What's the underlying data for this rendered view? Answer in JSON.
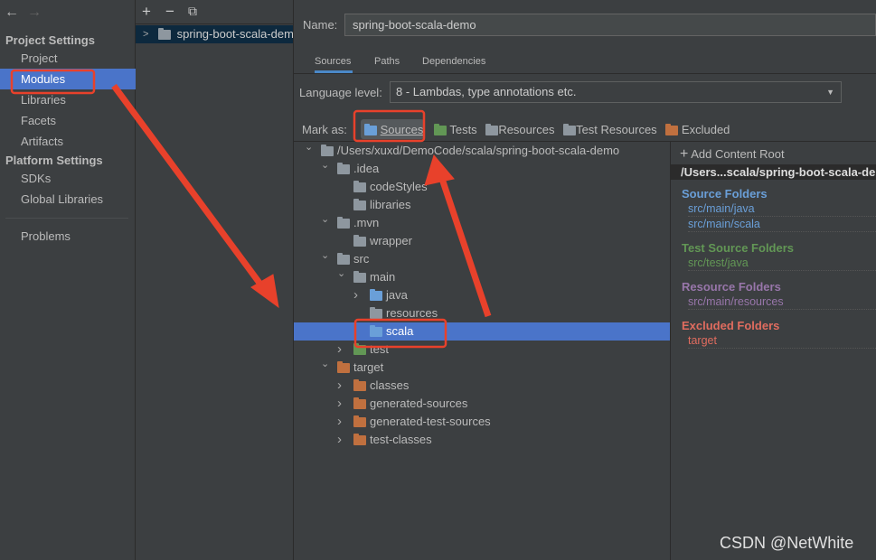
{
  "nav": {
    "back": "←",
    "forward": "→",
    "project_settings": "Project Settings",
    "items1": [
      "Project",
      "Modules",
      "Libraries",
      "Facets",
      "Artifacts"
    ],
    "platform_settings": "Platform Settings",
    "items2": [
      "SDKs",
      "Global Libraries"
    ],
    "problems": "Problems",
    "selected": "Modules"
  },
  "modules": {
    "add": "+",
    "remove": "−",
    "copy": "⧉",
    "module": "spring-boot-scala-demo"
  },
  "form": {
    "name_label": "Name:",
    "name_value": "spring-boot-scala-demo",
    "tabs": [
      "Sources",
      "Paths",
      "Dependencies"
    ],
    "active_tab": "Sources",
    "language_label": "Language level:",
    "language_value": "8 - Lambdas, type annotations etc.",
    "mark_label": "Mark as:",
    "marks": [
      "Sources",
      "Tests",
      "Resources",
      "Test Resources",
      "Excluded"
    ]
  },
  "tree": [
    {
      "label": "/Users/xuxd/DemoCode/scala/spring-boot-scala-demo",
      "level": 0,
      "chevron": "open",
      "type": "module"
    },
    {
      "label": ".idea",
      "level": 1,
      "chevron": "open",
      "type": "plain"
    },
    {
      "label": "codeStyles",
      "level": 2,
      "chevron": "none",
      "type": "plain"
    },
    {
      "label": "libraries",
      "level": 2,
      "chevron": "none",
      "type": "plain"
    },
    {
      "label": ".mvn",
      "level": 1,
      "chevron": "open",
      "type": "plain"
    },
    {
      "label": "wrapper",
      "level": 2,
      "chevron": "none",
      "type": "plain"
    },
    {
      "label": "src",
      "level": 1,
      "chevron": "open",
      "type": "plain"
    },
    {
      "label": "main",
      "level": 2,
      "chevron": "open",
      "type": "plain"
    },
    {
      "label": "java",
      "level": 3,
      "chevron": "closed",
      "type": "source"
    },
    {
      "label": "resources",
      "level": 3,
      "chevron": "none",
      "type": "resource"
    },
    {
      "label": "scala",
      "level": 3,
      "chevron": "none",
      "type": "source",
      "selected": true
    },
    {
      "label": "test",
      "level": 2,
      "chevron": "closed",
      "type": "test"
    },
    {
      "label": "target",
      "level": 1,
      "chevron": "open",
      "type": "excluded"
    },
    {
      "label": "classes",
      "level": 2,
      "chevron": "closed",
      "type": "excluded"
    },
    {
      "label": "generated-sources",
      "level": 2,
      "chevron": "closed",
      "type": "excluded"
    },
    {
      "label": "generated-test-sources",
      "level": 2,
      "chevron": "closed",
      "type": "excluded"
    },
    {
      "label": "test-classes",
      "level": 2,
      "chevron": "closed",
      "type": "excluded"
    }
  ],
  "roots": {
    "add": "Add Content Root",
    "root_path": "/Users...scala/spring-boot-scala-demo",
    "source_title": "Source Folders",
    "source": [
      "src/main/java",
      "src/main/scala"
    ],
    "test_title": "Test Source Folders",
    "test": [
      "src/test/java"
    ],
    "resource_title": "Resource Folders",
    "resource": [
      "src/main/resources"
    ],
    "excluded_title": "Excluded Folders",
    "excluded": [
      "target"
    ]
  },
  "colors": {
    "selection": "#4a74c9",
    "source": "#6a9fd8",
    "test": "#629755",
    "resource": "#9876aa",
    "excluded": "#e06c5f",
    "annotation": "#e8412b"
  },
  "watermark": "CSDN @NetWhite"
}
